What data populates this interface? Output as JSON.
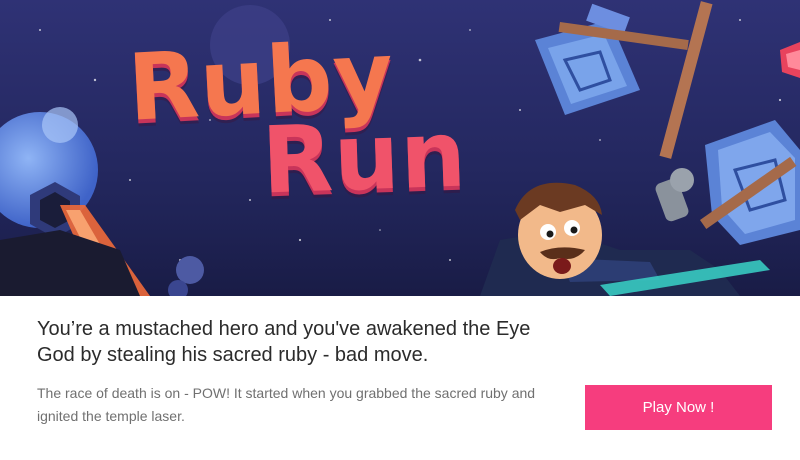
{
  "game": {
    "logo_line1": "Ruby",
    "logo_line2": "Run"
  },
  "info": {
    "headline": "You’re a mustached hero and you've awakened the Eye God by stealing his sacred ruby - bad move.",
    "description": "The race of death is on - POW! It started when you grabbed the sacred ruby and ignited the temple laser.",
    "play_button": "Play Now !"
  },
  "colors": {
    "accent": "#f63d7e",
    "sky_top": "#2a2d6e",
    "sky_bottom": "#1a1d4a",
    "logo_orange": "#f5774f",
    "logo_pink": "#f0536a"
  }
}
